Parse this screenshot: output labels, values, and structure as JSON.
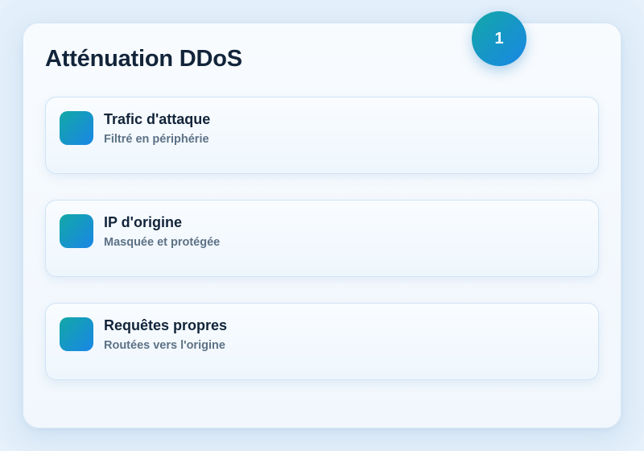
{
  "header": {
    "title": "Atténuation DDoS",
    "step_badge": "1"
  },
  "steps": [
    {
      "title": "Trafic d'attaque",
      "subtitle": "Filtré en périphérie",
      "icon": "gradient-square-icon"
    },
    {
      "title": "IP d'origine",
      "subtitle": "Masquée et protégée",
      "icon": "gradient-square-icon"
    },
    {
      "title": "Requêtes propres",
      "subtitle": "Routées vers l'origine",
      "icon": "gradient-square-icon"
    }
  ],
  "colors": {
    "accent_start": "#12a8a6",
    "accent_end": "#1a86e6",
    "text_primary": "#12243a",
    "text_secondary": "#5d7286"
  }
}
